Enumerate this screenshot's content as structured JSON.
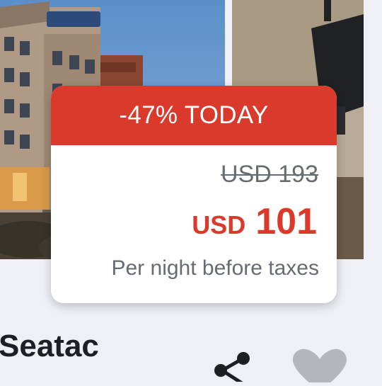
{
  "deal": {
    "discount_label": "-47% TODAY",
    "original_price": "USD 193",
    "price_currency": "USD",
    "price_amount": "101",
    "price_note": "Per night before taxes"
  },
  "hotel": {
    "name": "Seatac"
  },
  "icons": {
    "share": "share-icon",
    "favorite": "heart-icon"
  },
  "colors": {
    "accent": "#d93a2b",
    "muted_text": "#676c73",
    "background": "#eef0f6"
  }
}
